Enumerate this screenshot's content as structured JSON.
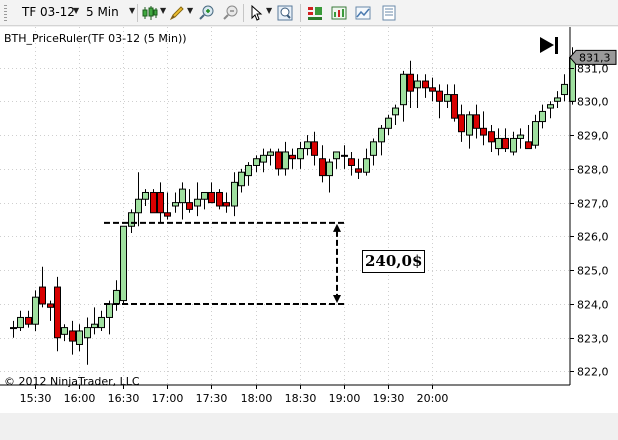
{
  "toolbar": {
    "instrument": "TF 03-12",
    "interval": "5 Min",
    "icons": [
      "bar-style-icon",
      "draw-pencil-icon",
      "zoom-in-icon",
      "zoom-out-icon",
      "cursor-icon",
      "magnifier-icon",
      "indicators-icon",
      "strategies-icon",
      "chart-properties-icon",
      "data-box-icon"
    ]
  },
  "chart": {
    "title": "BTH_PriceRuler(TF 03-12 (5 Min))",
    "copyright": "© 2012 NinjaTrader, LLC",
    "measure_label": "240,0$",
    "last_price_label": "831,3",
    "colors": {
      "up_fill": "#9fe09f",
      "down_fill": "#d80000",
      "outline": "#000000",
      "grid": "#cfcfcf"
    }
  },
  "chart_data": {
    "type": "candlestick",
    "x_ticks": [
      "15:30",
      "16:00",
      "16:30",
      "17:00",
      "17:30",
      "18:00",
      "18:30",
      "19:00",
      "19:30",
      "20:00"
    ],
    "y_ticks": [
      "822,0",
      "823,0",
      "824,0",
      "825,0",
      "826,0",
      "827,0",
      "828,0",
      "829,0",
      "830,0",
      "831,0"
    ],
    "ylim": [
      821.6,
      832.2
    ],
    "measure_range": [
      824.0,
      826.4
    ],
    "candles": [
      [
        823.3,
        823.5,
        823.0,
        823.3
      ],
      [
        823.3,
        823.8,
        823.2,
        823.6
      ],
      [
        823.6,
        823.8,
        823.3,
        823.4
      ],
      [
        823.4,
        824.4,
        823.2,
        824.2
      ],
      [
        824.5,
        825.1,
        823.9,
        824.0
      ],
      [
        824.0,
        824.1,
        823.5,
        823.9
      ],
      [
        824.5,
        824.8,
        822.6,
        823.0
      ],
      [
        823.1,
        823.4,
        822.9,
        823.3
      ],
      [
        823.2,
        823.5,
        822.5,
        822.9
      ],
      [
        822.8,
        823.4,
        822.6,
        823.2
      ],
      [
        823.0,
        823.6,
        822.2,
        823.3
      ],
      [
        823.3,
        823.9,
        823.1,
        823.4
      ],
      [
        823.3,
        823.8,
        823.2,
        823.6
      ],
      [
        823.6,
        824.1,
        823.1,
        824.0
      ],
      [
        824.0,
        824.7,
        823.8,
        824.4
      ],
      [
        824.1,
        826.3,
        824.0,
        826.3
      ],
      [
        826.3,
        826.8,
        826.1,
        826.7
      ],
      [
        826.7,
        827.9,
        826.3,
        827.1
      ],
      [
        827.1,
        827.4,
        826.9,
        827.3
      ],
      [
        827.3,
        827.4,
        826.8,
        826.7
      ],
      [
        827.3,
        827.6,
        826.4,
        826.7
      ],
      [
        826.7,
        827.3,
        826.5,
        826.6
      ],
      [
        826.9,
        827.3,
        826.7,
        827.0
      ],
      [
        827.0,
        827.6,
        826.5,
        827.4
      ],
      [
        827.0,
        827.4,
        826.7,
        826.8
      ],
      [
        826.9,
        827.6,
        826.6,
        827.1
      ],
      [
        827.1,
        827.3,
        826.8,
        827.3
      ],
      [
        827.3,
        827.6,
        827.0,
        827.0
      ],
      [
        827.3,
        827.4,
        826.8,
        826.9
      ],
      [
        827.0,
        827.3,
        826.7,
        826.9
      ],
      [
        826.9,
        827.9,
        826.6,
        827.6
      ],
      [
        827.5,
        828.0,
        827.3,
        827.9
      ],
      [
        827.8,
        828.2,
        827.5,
        828.1
      ],
      [
        828.1,
        828.4,
        827.9,
        828.3
      ],
      [
        828.2,
        828.6,
        827.9,
        828.4
      ],
      [
        828.4,
        828.6,
        828.1,
        828.5
      ],
      [
        828.5,
        828.6,
        827.8,
        828.0
      ],
      [
        828.0,
        828.8,
        827.8,
        828.5
      ],
      [
        828.4,
        828.6,
        828.0,
        828.3
      ],
      [
        828.3,
        828.8,
        828.0,
        828.6
      ],
      [
        828.6,
        829.0,
        828.4,
        828.8
      ],
      [
        828.8,
        829.1,
        828.1,
        828.4
      ],
      [
        828.3,
        828.7,
        827.6,
        827.8
      ],
      [
        827.8,
        828.3,
        827.3,
        828.2
      ],
      [
        828.3,
        828.5,
        828.0,
        828.5
      ],
      [
        828.4,
        828.7,
        828.0,
        828.4
      ],
      [
        828.3,
        828.5,
        827.8,
        828.1
      ],
      [
        828.0,
        828.3,
        827.7,
        827.9
      ],
      [
        827.9,
        828.6,
        827.8,
        828.3
      ],
      [
        828.4,
        828.9,
        828.1,
        828.8
      ],
      [
        828.8,
        829.3,
        828.4,
        829.2
      ],
      [
        829.2,
        829.6,
        829.0,
        829.5
      ],
      [
        829.6,
        829.9,
        829.3,
        829.8
      ],
      [
        829.9,
        830.9,
        829.4,
        830.8
      ],
      [
        830.8,
        831.2,
        829.8,
        830.3
      ],
      [
        830.4,
        830.8,
        829.8,
        830.6
      ],
      [
        830.6,
        830.8,
        830.1,
        830.4
      ],
      [
        830.4,
        830.7,
        830.0,
        830.3
      ],
      [
        830.3,
        830.5,
        829.5,
        830.0
      ],
      [
        830.0,
        830.5,
        829.8,
        830.2
      ],
      [
        830.2,
        830.5,
        829.4,
        829.5
      ],
      [
        829.6,
        829.9,
        828.8,
        829.1
      ],
      [
        829.0,
        829.7,
        828.6,
        829.6
      ],
      [
        829.6,
        829.9,
        828.9,
        829.2
      ],
      [
        829.2,
        829.7,
        828.7,
        829.0
      ],
      [
        829.1,
        829.3,
        828.5,
        828.8
      ],
      [
        828.6,
        829.2,
        828.4,
        828.9
      ],
      [
        828.9,
        829.2,
        828.5,
        828.6
      ],
      [
        828.5,
        829.1,
        828.4,
        828.9
      ],
      [
        828.9,
        829.2,
        828.6,
        829.0
      ],
      [
        828.8,
        829.3,
        828.6,
        828.6
      ],
      [
        828.7,
        829.6,
        828.6,
        829.4
      ],
      [
        829.4,
        829.9,
        829.2,
        829.7
      ],
      [
        829.8,
        830.0,
        829.5,
        829.9
      ],
      [
        830.0,
        830.3,
        829.8,
        830.1
      ],
      [
        830.2,
        830.8,
        830.0,
        830.5
      ],
      [
        830.0,
        831.6,
        829.9,
        831.3
      ]
    ]
  }
}
